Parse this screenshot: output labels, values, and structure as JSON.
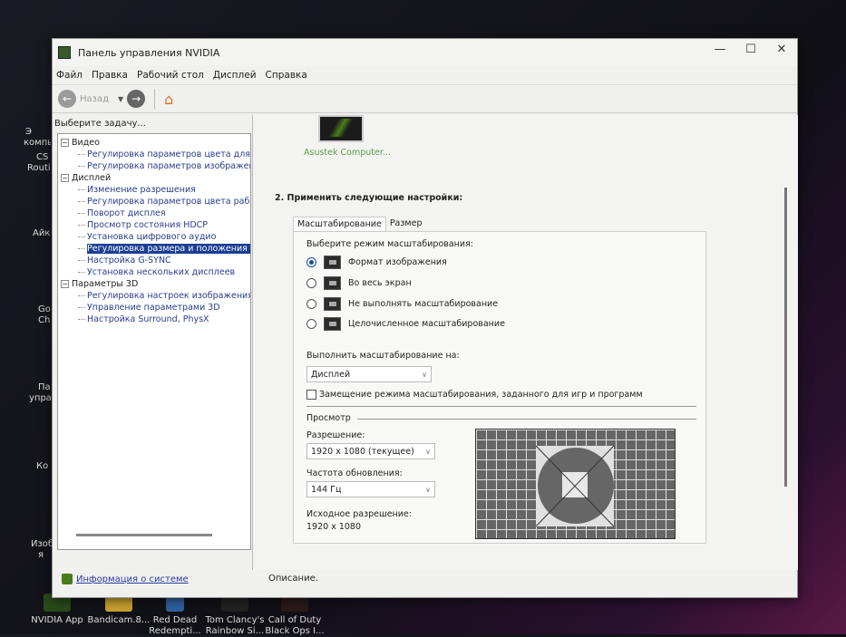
{
  "desktop": {
    "left_labels": [
      "Э",
      "компь",
      "CS",
      "Routi",
      "Айк",
      "Go",
      "Ch",
      "Па",
      "упра",
      "Ко",
      "Изоб",
      "я"
    ],
    "bottom_icons": [
      {
        "label": "NVIDIA App"
      },
      {
        "label": "Bandicam.8..."
      },
      {
        "label": "Red Dead Redempti..."
      },
      {
        "label": "Tom Clancy's Rainbow Si..."
      },
      {
        "label": "Call of Duty Black Ops I..."
      }
    ]
  },
  "window": {
    "title": "Панель управления NVIDIA",
    "controls": {
      "minimize": "—",
      "maximize": "☐",
      "close": "✕"
    },
    "menu": [
      "Файл",
      "Правка",
      "Рабочий стол",
      "Дисплей",
      "Справка"
    ],
    "toolbar": {
      "back": "Назад"
    },
    "left": {
      "heading": "Выберите задачу...",
      "tree": [
        {
          "label": "Видео",
          "items": [
            "Регулировка параметров цвета для вид",
            "Регулировка параметров изображения д"
          ]
        },
        {
          "label": "Дисплей",
          "items": [
            "Изменение разрешения",
            "Регулировка параметров цвета рабочег",
            "Поворот дисплея",
            "Просмотр состояния HDCP",
            "Установка цифрового аудио",
            "Регулировка размера и положения рабо",
            "Настройка G-SYNC",
            "Установка нескольких дисплеев"
          ]
        },
        {
          "label": "Параметры 3D",
          "items": [
            "Регулировка настроек изображения с пр",
            "Управление параметрами 3D",
            "Настройка Surround, PhysX"
          ]
        }
      ],
      "selected": "Регулировка размера и положения рабо",
      "system_info": "Информация о системе"
    },
    "right": {
      "monitor_label": "Asustek Computer...",
      "step_title": "2. Применить следующие настройки:",
      "tabs": [
        "Масштабирование",
        "Размер"
      ],
      "active_tab": "Масштабирование",
      "scaling_mode_label": "Выберите режим масштабирования:",
      "modes": [
        "Формат изображения",
        "Во весь экран",
        "Не выполнять масштабирование",
        "Целочисленное масштабирование"
      ],
      "selected_mode": "Формат изображения",
      "perform_on_label": "Выполнить масштабирование на:",
      "perform_on_value": "Дисплей",
      "override_label": "Замещение режима масштабирования, заданного для игр и программ",
      "override_checked": false,
      "preview_label": "Просмотр",
      "resolution_label": "Разрешение:",
      "resolution_value": "1920 x 1080 (текущее)",
      "refresh_label": "Частота обновления:",
      "refresh_value": "144 Гц",
      "native_label": "Исходное разрешение:",
      "native_value": "1920 x 1080"
    },
    "description": "Описание."
  }
}
